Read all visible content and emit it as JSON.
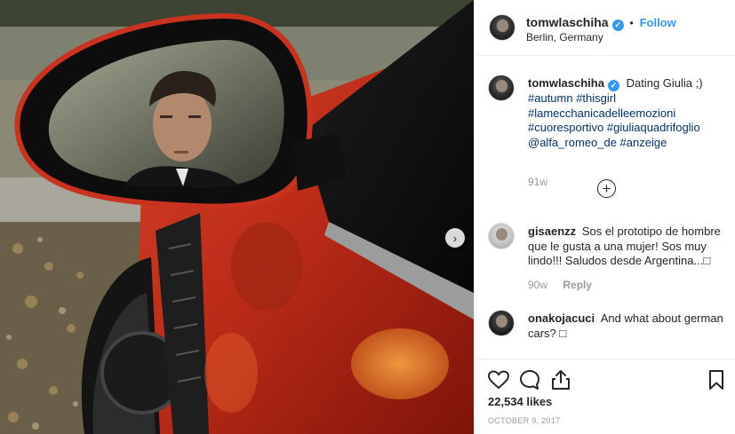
{
  "header": {
    "username": "tomwlaschiha",
    "verified_mark": "✓",
    "separator": "•",
    "follow_label": "Follow",
    "location": "Berlin, Germany"
  },
  "caption": {
    "username": "tomwlaschiha",
    "text": "Dating Giulia ;)",
    "tags_line1": "#autumn #thisgirl",
    "tags_line2": "#lamecchanicadelleemozioni",
    "tags_line3": "#cuoresportivo #giuliaquadrifoglio",
    "tags_line4": "@alfa_romeo_de #anzeige",
    "time": "91w"
  },
  "load_more_icon": "plus-circle-icon",
  "comments": [
    {
      "username": "gisaenzz",
      "line1": "Sos el prototipo de hombre",
      "line2": "que le gusta a una mujer! Sos muy",
      "line3": "lindo!!! Saludos desde Argentina...",
      "glyph": "□",
      "time": "90w",
      "reply_label": "Reply"
    },
    {
      "username": "onakojacuci",
      "line1": "And what about german",
      "line2": "cars?",
      "glyph": "□"
    }
  ],
  "actions": {
    "icons": [
      "heart-icon",
      "comment-icon",
      "share-icon",
      "bookmark-icon"
    ],
    "likes": "22,534 likes",
    "date": "OCTOBER 9, 2017"
  },
  "photo": {
    "next_arrow": "›",
    "car_color": "#c8321e"
  }
}
